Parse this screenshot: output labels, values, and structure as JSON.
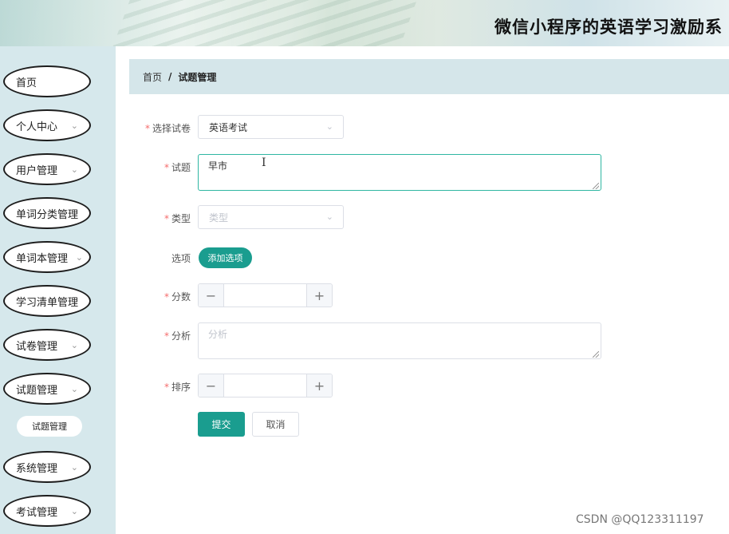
{
  "header": {
    "title": "微信小程序的英语学习激励系"
  },
  "sidebar": {
    "items": [
      {
        "label": "首页",
        "chevron": false
      },
      {
        "label": "个人中心",
        "chevron": true
      },
      {
        "label": "用户管理",
        "chevron": true
      },
      {
        "label": "单词分类管理",
        "chevron": false
      },
      {
        "label": "单词本管理",
        "chevron": true
      },
      {
        "label": "学习清单管理",
        "chevron": false
      },
      {
        "label": "试卷管理",
        "chevron": true
      },
      {
        "label": "试题管理",
        "chevron": true
      },
      {
        "label": "系统管理",
        "chevron": true
      },
      {
        "label": "考试管理",
        "chevron": true
      }
    ],
    "sub_item": "试题管理"
  },
  "breadcrumb": {
    "home": "首页",
    "separator": "/",
    "current": "试题管理"
  },
  "form": {
    "exam": {
      "label": "选择试卷",
      "value": "英语考试"
    },
    "question": {
      "label": "试题",
      "value": "早市"
    },
    "type": {
      "label": "类型",
      "placeholder": "类型"
    },
    "options": {
      "label": "选项",
      "button": "添加选项"
    },
    "score": {
      "label": "分数",
      "value": ""
    },
    "analysis": {
      "label": "分析",
      "placeholder": "分析"
    },
    "order": {
      "label": "排序",
      "value": ""
    },
    "required_mark": "*",
    "submit": "提交",
    "cancel": "取消"
  },
  "icons": {
    "select": "chevron-down-icon",
    "minus": "minus-icon",
    "plus": "plus-icon",
    "text-cursor": "text-cursor-icon"
  },
  "colors": {
    "accent": "#1a9d8f",
    "required": "#f56c6c",
    "sidebar_bg": "#d6e8ec",
    "breadcrumb_bg": "#d5e6ea"
  },
  "watermark": "CSDN @QQ123311197"
}
